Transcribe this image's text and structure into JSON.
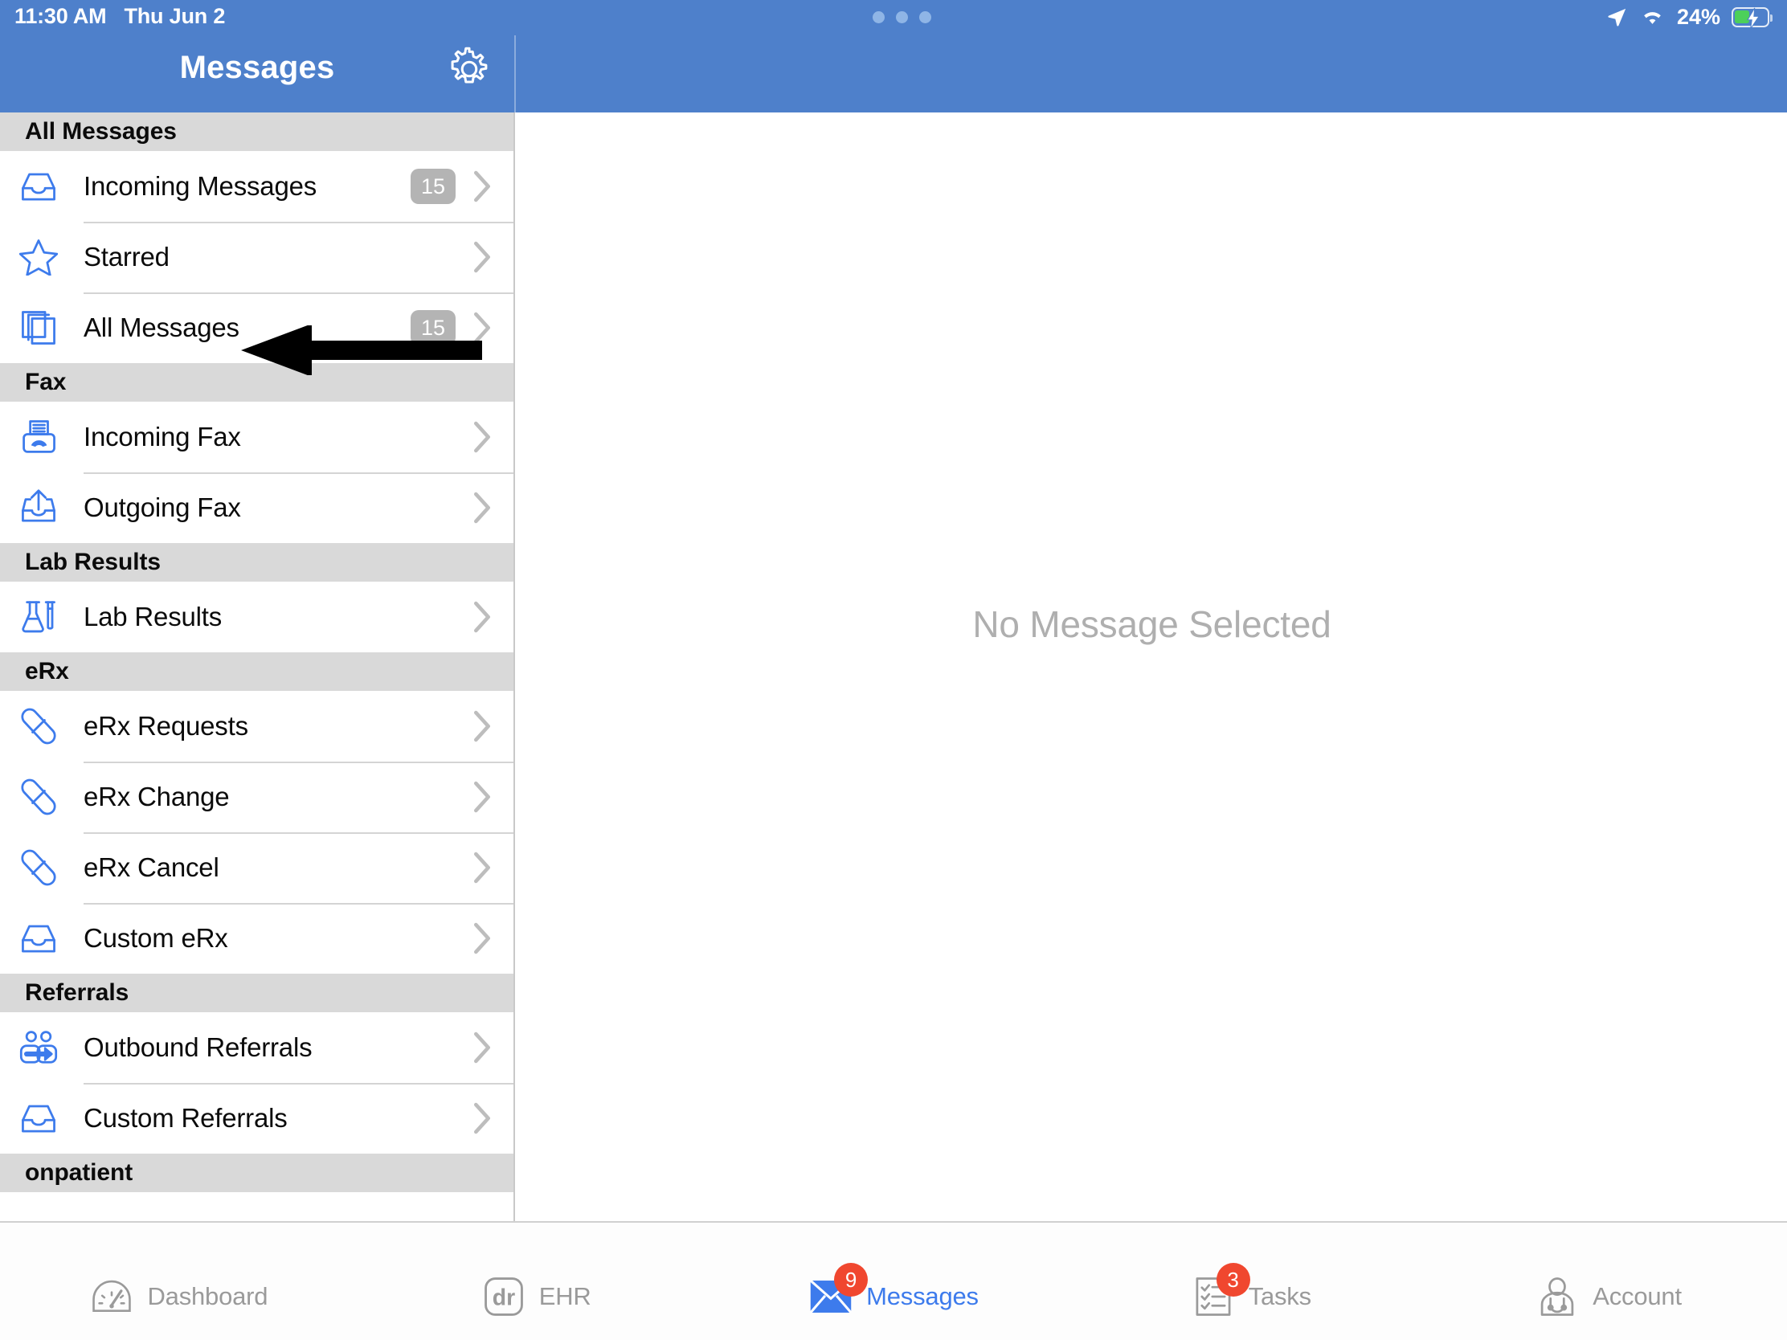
{
  "status_bar": {
    "time": "11:30 AM",
    "date": "Thu Jun 2",
    "location_icon": "location-arrow-icon",
    "wifi_icon": "wifi-icon",
    "battery_percent": "24%",
    "battery_state": "charging",
    "multitask_handle": "three-dots-handle"
  },
  "nav": {
    "title": "Messages",
    "settings_icon": "gear-icon"
  },
  "sidebar": {
    "sections": [
      {
        "title": "All Messages",
        "items": [
          {
            "label": "Incoming Messages",
            "icon": "inbox-tray-icon",
            "badge": "15"
          },
          {
            "label": "Starred",
            "icon": "star-icon",
            "badge": ""
          },
          {
            "label": "All Messages",
            "icon": "stacked-pages-icon",
            "badge": "15"
          }
        ]
      },
      {
        "title": "Fax",
        "items": [
          {
            "label": "Incoming Fax",
            "icon": "fax-machine-icon",
            "badge": ""
          },
          {
            "label": "Outgoing Fax",
            "icon": "outbox-up-arrow-icon",
            "badge": ""
          }
        ]
      },
      {
        "title": "Lab Results",
        "items": [
          {
            "label": "Lab Results",
            "icon": "flask-test-tube-icon",
            "badge": ""
          }
        ]
      },
      {
        "title": "eRx",
        "items": [
          {
            "label": "eRx Requests",
            "icon": "pill-capsule-icon",
            "badge": ""
          },
          {
            "label": "eRx Change",
            "icon": "pill-capsule-icon",
            "badge": ""
          },
          {
            "label": "eRx Cancel",
            "icon": "pill-capsule-icon",
            "badge": ""
          },
          {
            "label": "Custom eRx",
            "icon": "inbox-tray-icon",
            "badge": ""
          }
        ]
      },
      {
        "title": "Referrals",
        "items": [
          {
            "label": "Outbound Referrals",
            "icon": "people-arrow-icon",
            "badge": ""
          },
          {
            "label": "Custom Referrals",
            "icon": "inbox-tray-icon",
            "badge": ""
          }
        ]
      },
      {
        "title": "onpatient",
        "items": []
      }
    ]
  },
  "detail": {
    "empty_message": "No Message Selected"
  },
  "tabbar": {
    "tabs": [
      {
        "label": "Dashboard",
        "icon": "speedometer-icon",
        "badge": "",
        "active": false
      },
      {
        "label": "EHR",
        "icon": "dr-logo-icon",
        "badge": "",
        "active": false
      },
      {
        "label": "Messages",
        "icon": "envelope-icon",
        "badge": "9",
        "active": true
      },
      {
        "label": "Tasks",
        "icon": "checklist-icon",
        "badge": "3",
        "active": false
      },
      {
        "label": "Account",
        "icon": "doctor-stethoscope-icon",
        "badge": "",
        "active": false
      }
    ]
  },
  "annotation": {
    "arrow": "left-pointing-arrow",
    "points_at": "All Messages"
  },
  "colors": {
    "header_blue": "#4E80CB",
    "accent_blue": "#3D7BEC",
    "section_gray": "#D9D9D9",
    "badge_gray": "#B4B4B4",
    "badge_red": "#F0472F"
  }
}
